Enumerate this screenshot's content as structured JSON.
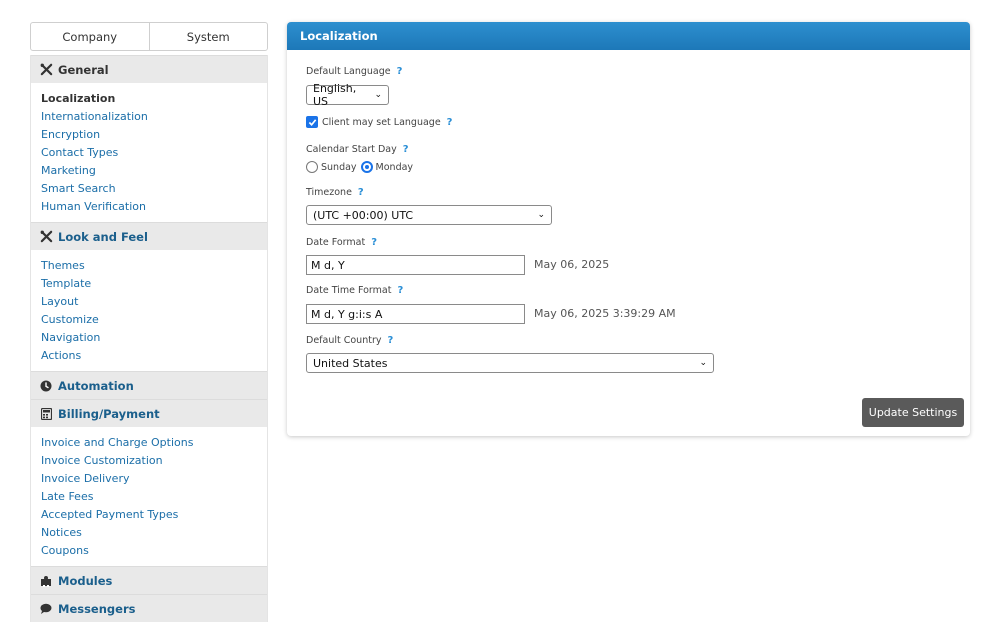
{
  "tabs": [
    "Company",
    "System"
  ],
  "sidebar": {
    "sections": [
      {
        "name": "General",
        "icon": "tools-icon",
        "items": [
          "Localization",
          "Internationalization",
          "Encryption",
          "Contact Types",
          "Marketing",
          "Smart Search",
          "Human Verification"
        ],
        "active": "Localization"
      },
      {
        "name": "Look and Feel",
        "icon": "tools-icon",
        "items": [
          "Themes",
          "Template",
          "Layout",
          "Customize",
          "Navigation",
          "Actions"
        ]
      },
      {
        "name": "Automation",
        "icon": "clock-icon",
        "items": []
      },
      {
        "name": "Billing/Payment",
        "icon": "calculator-icon",
        "items": [
          "Invoice and Charge Options",
          "Invoice Customization",
          "Invoice Delivery",
          "Late Fees",
          "Accepted Payment Types",
          "Notices",
          "Coupons"
        ]
      },
      {
        "name": "Modules",
        "icon": "puzzle-icon",
        "items": []
      },
      {
        "name": "Messengers",
        "icon": "chat-icon",
        "items": []
      }
    ]
  },
  "panel": {
    "title": "Localization",
    "help": "?",
    "default_language": {
      "label": "Default Language",
      "value": "English, US"
    },
    "client_set_language": {
      "label": "Client may set Language",
      "checked": true
    },
    "calendar_start": {
      "label": "Calendar Start Day",
      "options": [
        "Sunday",
        "Monday"
      ],
      "selected": "Monday"
    },
    "timezone": {
      "label": "Timezone",
      "value": "(UTC +00:00) UTC"
    },
    "date_format": {
      "label": "Date Format",
      "value": "M d, Y",
      "preview": "May 06, 2025"
    },
    "datetime_format": {
      "label": "Date Time Format",
      "value": "M d, Y g:i:s A",
      "preview": "May 06, 2025 3:39:29 AM"
    },
    "default_country": {
      "label": "Default Country",
      "value": "United States"
    },
    "update_button": "Update Settings"
  }
}
